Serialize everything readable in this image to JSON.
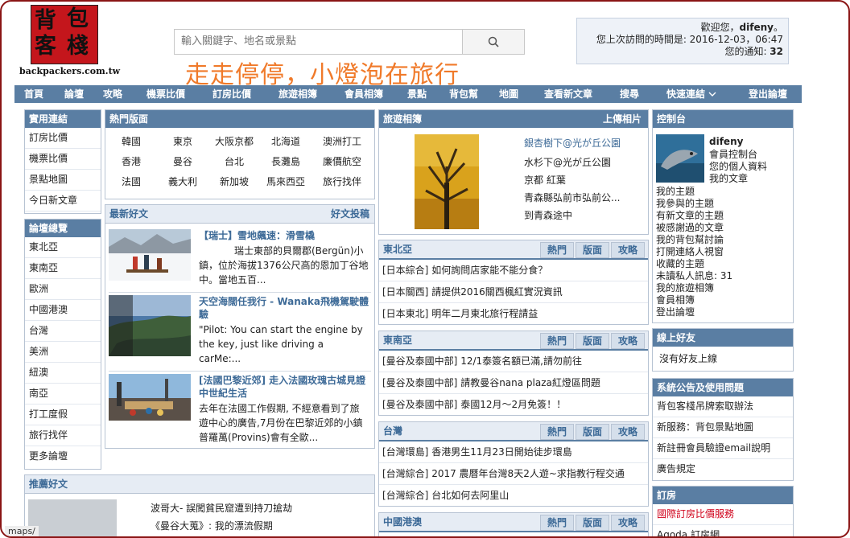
{
  "header": {
    "logo_chars": [
      "背",
      "包",
      "客",
      "棧"
    ],
    "logo_url": "backpackers.com.tw",
    "search_placeholder": "輸入關鍵字、地名或景點",
    "slogan": "走走停停，小燈泡在旅行",
    "welcome": {
      "greeting": "歡迎您，",
      "username": "difeny",
      "greeting_end": "。",
      "last_visit_label": "您上次訪問的時間是: ",
      "last_visit": "2016-12-03，06:47",
      "notify_label": "您的通知: ",
      "notify_count": "32"
    }
  },
  "nav": [
    "首頁",
    "論壇",
    "攻略",
    "機票比價",
    "訂房比價",
    "旅遊相簿",
    "會員相簿",
    "景點",
    "背包幫",
    "地圖",
    "查看新文章",
    "搜尋",
    "快速連結",
    "登出論壇"
  ],
  "useful_links": {
    "title": "實用連結",
    "items": [
      "訂房比價",
      "機票比價",
      "景點地圖",
      "今日新文章"
    ]
  },
  "forum_overview": {
    "title": "論壇總覽",
    "items": [
      "東北亞",
      "東南亞",
      "歐洲",
      "中國港澳",
      "台灣",
      "美洲",
      "紐澳",
      "南亞",
      "打工度假",
      "旅行找伴",
      "更多論壇"
    ]
  },
  "hot_boards": {
    "title": "熱門版面",
    "rows": [
      [
        "韓國",
        "東京",
        "大阪京都",
        "北海道",
        "澳洲打工"
      ],
      [
        "香港",
        "曼谷",
        "台北",
        "長灘島",
        "廉價航空"
      ],
      [
        "法國",
        "義大利",
        "新加坡",
        "馬來西亞",
        "旅行找伴"
      ]
    ]
  },
  "latest_articles": {
    "title": "最新好文",
    "action": "好文投稿",
    "items": [
      {
        "title": "【瑞士】雪地飆速：滑雪橇",
        "text": [
          "瑞士東部的貝爾郡(Bergün)小",
          "鎮，位於海拔1376公尺高的恩加丁谷地",
          "中。當地五百..."
        ]
      },
      {
        "title": "天空海闊任我行 - Wanaka飛機駕駛體驗",
        "text": [
          "\"Pilot: You can start the engine by",
          "the key, just like driving a",
          "carMe:..."
        ]
      },
      {
        "title": "[法國巴黎近郊] 走入法國玫瑰古城見證中世紀生活",
        "text": [
          "去年在法國工作假期, 不經意看到了旅",
          "遊中心的廣告,7月份在巴黎近郊的小鎮",
          "普羅萬(Provins)會有全歐..."
        ]
      }
    ]
  },
  "recommended": {
    "title": "推薦好文",
    "items": [
      "波哥大- 誤闖貧民窟遭到持刀搶劫",
      "《曼谷大蒐》: 我的漂流假期"
    ]
  },
  "photo_album": {
    "title": "旅遊相簿",
    "action": "上傳相片",
    "items": [
      "銀杏樹下@光が丘公園",
      "水杉下@光が丘公園",
      "京都 紅葉",
      "青森縣弘前市弘前公...",
      "到青森途中"
    ]
  },
  "tabs": [
    "熱門",
    "版面",
    "攻略"
  ],
  "forums": [
    {
      "name": "東北亞",
      "topics": [
        [
          "[日本綜合]",
          "如何詢問店家能不能分食？"
        ],
        [
          "[日本關西]",
          "請提供2016關西楓紅實況資訊"
        ],
        [
          "[日本東北]",
          "明年二月東北旅行程請益"
        ]
      ]
    },
    {
      "name": "東南亞",
      "topics": [
        [
          "[曼谷及泰國中部]",
          "12/1泰簽名額已滿,請勿前往"
        ],
        [
          "[曼谷及泰國中部]",
          "請教曼谷nana plaza紅燈區問題"
        ],
        [
          "[曼谷及泰國中部]",
          "泰國12月～2月免簽！！"
        ]
      ]
    },
    {
      "name": "台灣",
      "topics": [
        [
          "[台灣環島]",
          "香港男生11月23日開始徒步環島"
        ],
        [
          "[台灣綜合]",
          "2017 農曆年台灣8天2人遊~求指教行程交通"
        ],
        [
          "[台灣綜合]",
          "台北如何去阿里山"
        ]
      ]
    },
    {
      "name": "中國港澳",
      "topics": []
    }
  ],
  "control_panel": {
    "title": "控制台",
    "username": "difeny",
    "user_links": [
      "會員控制台",
      "您的個人資料",
      "我的文章"
    ],
    "links": [
      "我的主題",
      "我參與的主題",
      "有新文章的主題",
      "被感謝過的文章",
      "我的背包幫討論",
      "打開連絡人視窗",
      "收藏的主題",
      "未讀私人訊息: 31",
      "我的旅遊相簿",
      "會員相簿",
      "登出論壇"
    ]
  },
  "online_friends": {
    "title": "線上好友",
    "text": "沒有好友上線"
  },
  "announcements": {
    "title": "系統公告及使用問題",
    "items": [
      "背包客棧吊牌索取辦法",
      "新服務：背包景點地圖",
      "新註冊會員驗證email說明",
      "廣告規定"
    ]
  },
  "booking": {
    "title": "訂房",
    "items": [
      "國際訂房比價服務",
      "Agoda 訂房網"
    ]
  },
  "status_bar": "maps/",
  "colors": {
    "nav": "#5a7ea3",
    "accent_link": "#3d6a97",
    "slogan": "#f07a2a",
    "logo": "#c4161c",
    "frame": "#8a1414"
  }
}
